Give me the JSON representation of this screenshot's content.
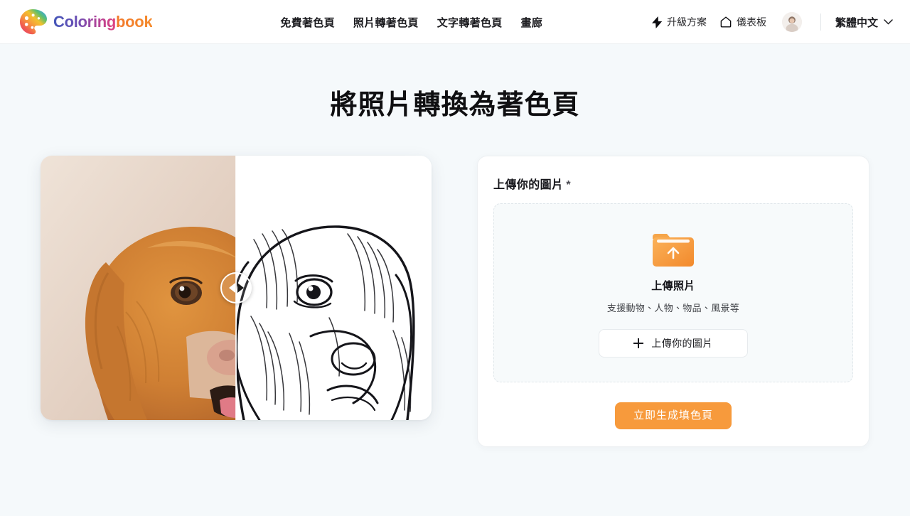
{
  "brand": {
    "name_part1": "Coloring",
    "name_part2": "book",
    "logo_icon": "palette-icon",
    "colors": {
      "part1_gradient_start": "#4457b8",
      "part1_gradient_end": "#e0417e",
      "part2": "#f2792c"
    }
  },
  "nav": {
    "items": [
      {
        "label": "免費著色頁",
        "name": "free-coloring-pages"
      },
      {
        "label": "照片轉著色頁",
        "name": "photo-to-coloring-page"
      },
      {
        "label": "文字轉著色頁",
        "name": "text-to-coloring-page"
      },
      {
        "label": "畫廊",
        "name": "gallery"
      }
    ]
  },
  "header_right": {
    "upgrade_label": "升級方案",
    "upgrade_icon": "lightning-bolt-icon",
    "dashboard_label": "儀表板",
    "dashboard_icon": "home-icon",
    "avatar_icon": "user-avatar",
    "language_label": "繁體中文",
    "language_chevron_icon": "chevron-down-icon"
  },
  "page": {
    "title": "將照片轉換為著色頁",
    "background_color": "#f5f9fb"
  },
  "preview": {
    "name": "before-after-comparison",
    "before_alt": "金毛獵犬照片",
    "after_alt": "金毛獵犬線稿著色頁",
    "handle_icon": "slider-handle-icon",
    "split_position_percent": 50
  },
  "upload_card": {
    "label": "上傳你的圖片",
    "required_marker": "*",
    "dropzone": {
      "icon": "folder-upload-icon",
      "title": "上傳照片",
      "subtitle": "支援動物、人物、物品、風景等",
      "button_label": "上傳你的圖片",
      "button_icon": "plus-icon"
    },
    "cta_label": "立即生成填色頁",
    "cta_color": "#f79a3c"
  }
}
